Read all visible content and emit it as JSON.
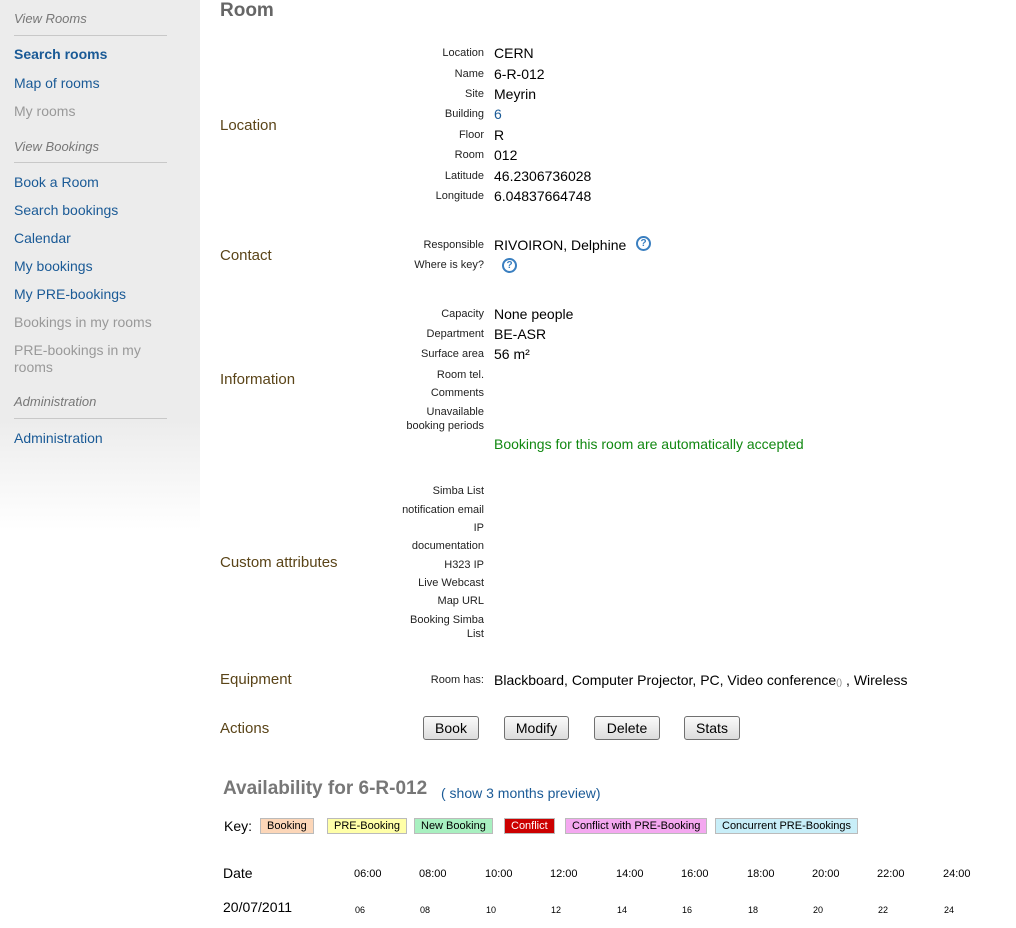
{
  "sidebar": {
    "sections": [
      {
        "title": "View Rooms",
        "items": [
          {
            "label": "Search rooms",
            "state": "active"
          },
          {
            "label": "Map of rooms",
            "state": "link"
          },
          {
            "label": "My rooms",
            "state": "disabled"
          }
        ]
      },
      {
        "title": "View Bookings",
        "items": [
          {
            "label": "Book a Room",
            "state": "link"
          },
          {
            "label": "Search bookings",
            "state": "link"
          },
          {
            "label": "Calendar",
            "state": "link"
          },
          {
            "label": "My bookings",
            "state": "link"
          },
          {
            "label": "My PRE-bookings",
            "state": "link"
          },
          {
            "label": "Bookings in my rooms",
            "state": "disabled"
          },
          {
            "label": "PRE-bookings in my rooms",
            "state": "disabled"
          }
        ]
      },
      {
        "title": "Administration",
        "items": [
          {
            "label": "Administration",
            "state": "link"
          }
        ]
      }
    ]
  },
  "page": {
    "title": "Room"
  },
  "location": {
    "section_label": "Location",
    "fields": [
      {
        "label": "Location",
        "value": "CERN"
      },
      {
        "label": "Name",
        "value": "6-R-012"
      },
      {
        "label": "Site",
        "value": "Meyrin"
      },
      {
        "label": "Building",
        "value": "6"
      },
      {
        "label": "Floor",
        "value": "R"
      },
      {
        "label": "Room",
        "value": "012"
      },
      {
        "label": "Latitude",
        "value": "46.2306736028"
      },
      {
        "label": "Longitude",
        "value": "6.04837664748"
      }
    ]
  },
  "contact": {
    "section_label": "Contact",
    "responsible_label": "Responsible",
    "responsible_value": "RIVOIRON, Delphine",
    "key_label": "Where is key?",
    "help_glyph": "?"
  },
  "information": {
    "section_label": "Information",
    "capacity_label": "Capacity",
    "capacity_value": "None people",
    "department_label": "Department",
    "department_value": "BE-ASR",
    "surface_label": "Surface area",
    "surface_value": "56 m²",
    "tel_label": "Room tel.",
    "comments_label": "Comments",
    "unavailable_label_1": "Unavailable",
    "unavailable_label_2": "booking periods",
    "auto_accept": "Bookings for this room are automatically accepted"
  },
  "custom_attributes": {
    "section_label": "Custom attributes",
    "labels": [
      "Simba List",
      "notification email",
      "IP",
      "documentation",
      "H323 IP",
      "Live Webcast",
      "Map URL"
    ],
    "booking_simba_1": "Booking Simba",
    "booking_simba_2": "List"
  },
  "equipment": {
    "section_label": "Equipment",
    "label": "Room has:",
    "value_before": "Blackboard, Computer Projector, PC, Video conference",
    "paren": "()",
    "value_after": " , Wireless"
  },
  "actions": {
    "section_label": "Actions",
    "buttons": [
      "Book",
      "Modify",
      "Delete",
      "Stats"
    ]
  },
  "availability": {
    "title": "Availability for 6-R-012",
    "preview_link": "( show 3 months preview)",
    "key_label": "Key:",
    "key_items": [
      {
        "label": "Booking",
        "bg": "#fcd6b8"
      },
      {
        "label": "PRE-Booking",
        "bg": "#ffffa8"
      },
      {
        "label": "New Booking",
        "bg": "#a8f0c0"
      },
      {
        "label": "Conflict",
        "bg": "#cc0000"
      },
      {
        "label": "Conflict with PRE-Booking",
        "bg": "#f4a8f0"
      },
      {
        "label": "Concurrent PRE-Bookings",
        "bg": "#c8eef8"
      }
    ],
    "date_header": "Date",
    "hours": [
      "06:00",
      "08:00",
      "10:00",
      "12:00",
      "14:00",
      "16:00",
      "18:00",
      "20:00",
      "22:00",
      "24:00"
    ],
    "row_date": "20/07/2011",
    "ticks": [
      "06",
      "08",
      "10",
      "12",
      "14",
      "16",
      "18",
      "20",
      "22",
      "24"
    ]
  },
  "colors": {
    "link": "#1a5a96",
    "section_label": "#5a4418",
    "accepted_text": "#118811"
  }
}
